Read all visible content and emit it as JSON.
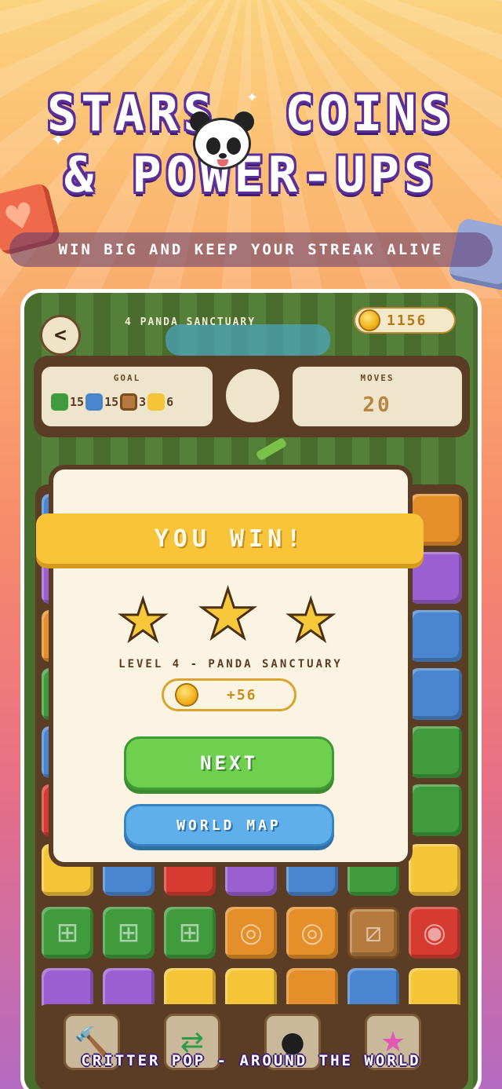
{
  "promo": {
    "headline_line1": "STARS, COINS",
    "headline_line2": "& POWER-UPS",
    "subtitle": "WIN BIG AND KEEP YOUR STREAK ALIVE",
    "footer": "CRITTER POP - AROUND THE WORLD"
  },
  "game": {
    "level_name": "4 PANDA SANCTUARY",
    "coins": "1156",
    "goal_label": "GOAL",
    "goals": [
      {
        "icon": "green-tile-icon",
        "count": "15"
      },
      {
        "icon": "blue-vase-tile-icon",
        "count": "15"
      },
      {
        "icon": "crate-tile-icon",
        "count": "3"
      },
      {
        "icon": "gold-tile-icon",
        "count": "6"
      }
    ],
    "moves_label": "MOVES",
    "moves_value": "20"
  },
  "modal": {
    "banner": "YOU WIN!",
    "stars_earned": 3,
    "stars_total": 3,
    "level_line": "LEVEL 4 - PANDA SANCTUARY",
    "reward": "+56",
    "next_label": "NEXT",
    "map_label": "WORLD MAP"
  },
  "icons": {
    "back": "back-chevron-icon",
    "boosters": [
      "hammer-icon",
      "shuffle-icon",
      "bomb-icon",
      "rainbow-star-icon"
    ]
  },
  "colors": {
    "accent_gold": "#f7c43a",
    "next_green": "#6fcf4f",
    "map_blue": "#5fb0ea",
    "frame_brown": "#5b3d26",
    "headline_purple": "#5a2f9a"
  }
}
